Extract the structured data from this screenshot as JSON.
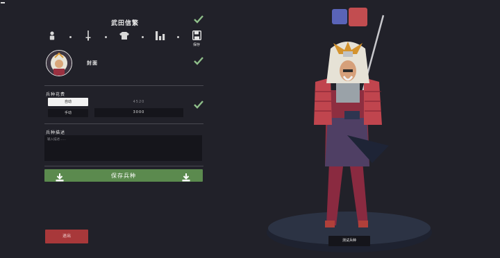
{
  "header": {
    "unit_name": "武田信繁"
  },
  "tabs": [
    {
      "name": "character",
      "icon": "person-icon"
    },
    {
      "name": "weapon",
      "icon": "sword-icon"
    },
    {
      "name": "armor",
      "icon": "shirt-icon"
    },
    {
      "name": "stats",
      "icon": "bar-chart-icon"
    },
    {
      "name": "save",
      "icon": "save-icon",
      "label": "保存"
    }
  ],
  "cover": {
    "label": "封面"
  },
  "cost": {
    "section_label": "兵种花费",
    "auto_button": "自动",
    "auto_value": "4520",
    "manual_button": "手动",
    "manual_value": "3000"
  },
  "description": {
    "section_label": "兵种描述",
    "placeholder": "输入描述……"
  },
  "save_button": {
    "label": "保存兵种"
  },
  "exit_button": {
    "label": "退出"
  },
  "preview": {
    "test_button": "测试兵种"
  },
  "colors": {
    "accent_green": "#5b8a4e",
    "exit_red": "#a8383a",
    "team_blue": "#5a64b8",
    "team_red": "#c24d50",
    "check": "#8fbf8a"
  }
}
